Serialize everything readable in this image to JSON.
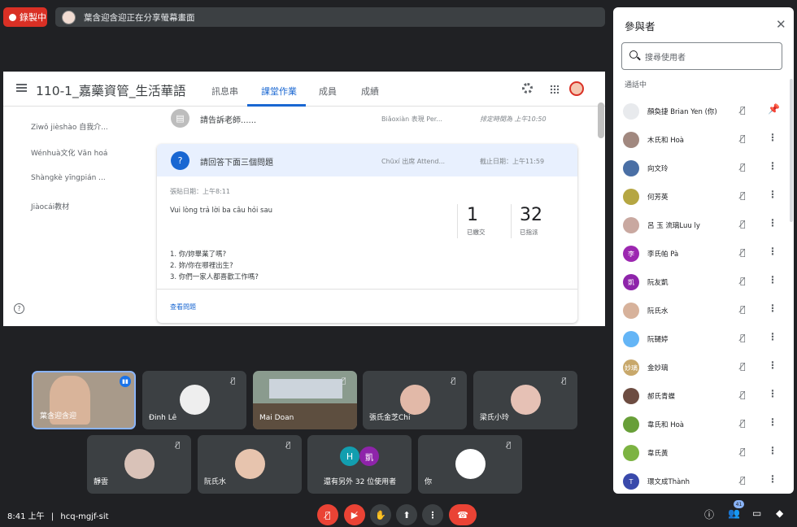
{
  "recording": {
    "label": "錄製中"
  },
  "share": {
    "text": "葉含迎含迎正在分享螢幕畫面"
  },
  "classroom": {
    "title": "110-1_嘉藥資管_生活華語",
    "tabs": [
      "訊息串",
      "課堂作業",
      "成員",
      "成績"
    ],
    "sidebar": [
      "Ziwǒ jièshào 自我介...",
      "Wénhuà文化 Văn hoá",
      "Shàngkè yīngpián ...",
      "Jiàocái教材"
    ],
    "post1": {
      "title": "請告訴老師......",
      "topic": "Biǎoxiàn 表現 Per...",
      "date": "排定時間為 上午10:50"
    },
    "card": {
      "title": "請回答下面三個問題",
      "topic": "Chūxí 出席 Attend...",
      "due": "截止日期：上午11:59",
      "posted": "張貼日期：上午8:11",
      "desc": "Vui lòng trả lời ba câu hỏi sau",
      "turned_in": "1",
      "turned_in_label": "已繳交",
      "assigned": "32",
      "assigned_label": "已指派",
      "q1": "1. 你/妳畢業了嗎?",
      "q2": "2. 妳/你在哪裡出生?",
      "q3": "3. 你們一家人都喜歡工作嗎?",
      "link": "查看問題"
    }
  },
  "tiles": [
    {
      "name": "葉含迎含迎"
    },
    {
      "name": "Đinh Lê"
    },
    {
      "name": "Mai Doan"
    },
    {
      "name": "張氏金芝Chi"
    },
    {
      "name": "梁氏小玲"
    },
    {
      "name": "靜雲"
    },
    {
      "name": "阮氏水"
    },
    {
      "name": "還有另外 32 位使用者",
      "a1": "H",
      "a2": "凱"
    },
    {
      "name": "你"
    }
  ],
  "panel": {
    "title": "參與者",
    "search_placeholder": "搜尋使用者",
    "section": "通話中",
    "people": [
      {
        "name": "顏奐捷 Brian Yen (你)",
        "av": "",
        "color": "#e8eaed"
      },
      {
        "name": "木氏和 Hoà",
        "av": "",
        "color": "#a1887f"
      },
      {
        "name": "向文玲",
        "av": "",
        "color": "#4a6fa5"
      },
      {
        "name": "何芳英",
        "av": "",
        "color": "#b5a642"
      },
      {
        "name": "呂 玉 流璃Luu ly",
        "av": "",
        "color": "#c9a8a0"
      },
      {
        "name": "李氏帕 Pà",
        "av": "李",
        "color": "#9c27b0"
      },
      {
        "name": "阮友凱",
        "av": "凱",
        "color": "#8e24aa"
      },
      {
        "name": "阮氏水",
        "av": "",
        "color": "#d7b29b"
      },
      {
        "name": "阮韆婷",
        "av": "",
        "color": "#64b5f6"
      },
      {
        "name": "金妙璃",
        "av": "妙璃",
        "color": "#c8a86b"
      },
      {
        "name": "郝氏青蝶",
        "av": "",
        "color": "#6d4c41"
      },
      {
        "name": "韋氏和 Hoà",
        "av": "",
        "color": "#689f38"
      },
      {
        "name": "韋氏黃",
        "av": "",
        "color": "#7cb342"
      },
      {
        "name": "環文成Thành",
        "av": "T",
        "color": "#3949ab"
      }
    ]
  },
  "bottom": {
    "time": "8:41 上午",
    "separator": "|",
    "meeting": "hcq-mgjf-sit",
    "count": "41"
  }
}
